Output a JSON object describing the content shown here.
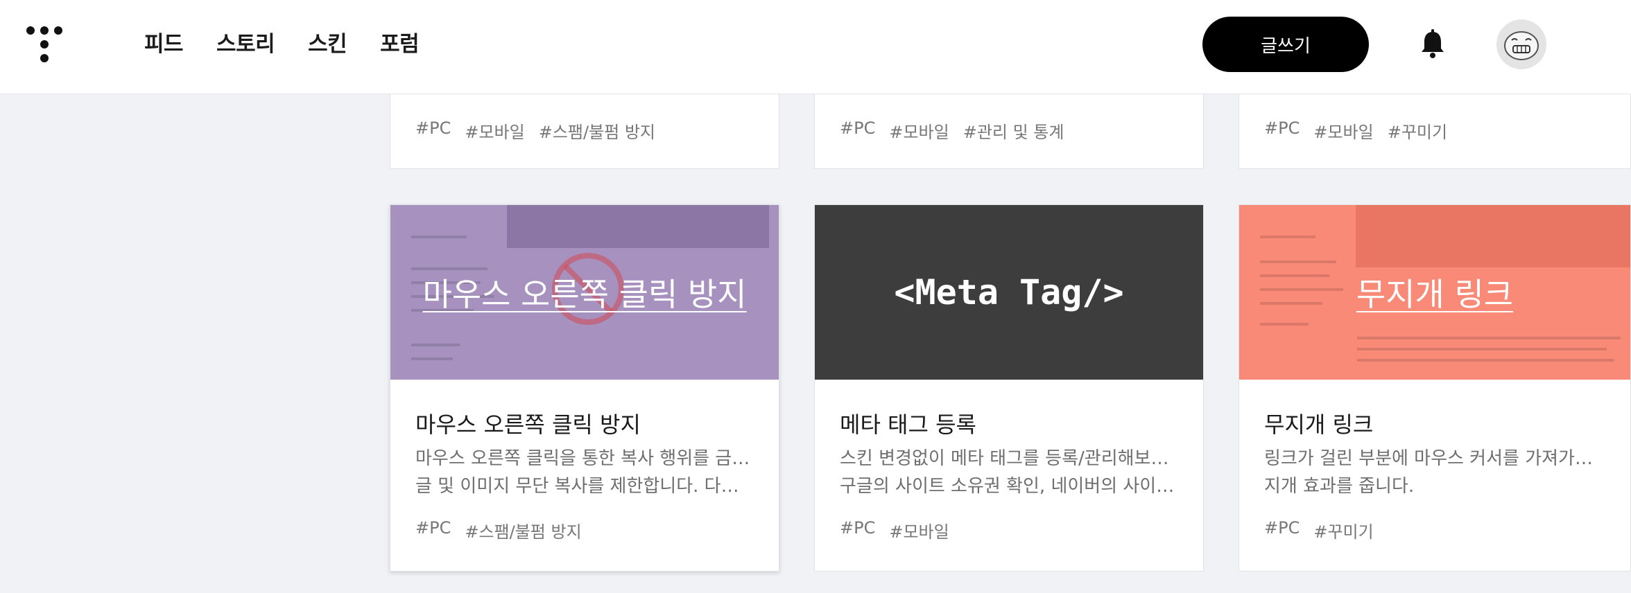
{
  "nav": {
    "items": [
      "피드",
      "스토리",
      "스킨",
      "포럼"
    ]
  },
  "header": {
    "write_label": "글쓰기"
  },
  "top_cards": [
    {
      "tags": [
        "#PC",
        "#모바일",
        "#스팸/불펌 방지"
      ]
    },
    {
      "tags": [
        "#PC",
        "#모바일",
        "#관리 및 통계"
      ]
    },
    {
      "tags": [
        "#PC",
        "#모바일",
        "#꾸미기"
      ]
    }
  ],
  "cards": [
    {
      "thumb_text": "마우스 오른쪽 클릭 방지",
      "title": "마우스 오른쪽 클릭 방지",
      "desc_line1": "마우스 오른쪽 클릭을 통한 복사 행위를 금지해",
      "desc_line2": "글 및 이미지 무단 복사를 제한합니다. 다만 …",
      "tags": [
        "#PC",
        "#스팸/불펌 방지"
      ],
      "thumb_color": "#a691bf"
    },
    {
      "thumb_text": "<Meta Tag/>",
      "title": "메타 태그 등록",
      "desc_line1": "스킨 변경없이 메타 태그를 등록/관리해보세요.",
      "desc_line2": "구글의 사이트 소유권 확인, 네이버의 사이트…",
      "tags": [
        "#PC",
        "#모바일"
      ],
      "thumb_color": "#3d3d3d"
    },
    {
      "thumb_text": "무지개 링크",
      "title": "무지개 링크",
      "desc_line1": "링크가 걸린 부분에 마우스 커서를 가져가면 무",
      "desc_line2": "지개 효과를 줍니다.",
      "tags": [
        "#PC",
        "#꾸미기"
      ],
      "thumb_color": "#f98a78"
    }
  ]
}
